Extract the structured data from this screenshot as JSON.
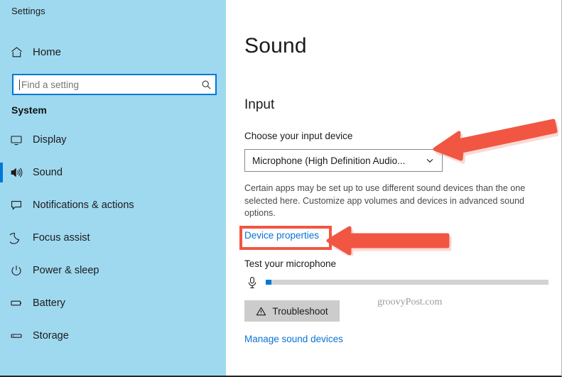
{
  "app": {
    "title": "Settings"
  },
  "sidebar": {
    "home": {
      "label": "Home",
      "icon": "home-icon"
    },
    "search": {
      "placeholder": "Find a setting",
      "value": "",
      "icon": "search-icon"
    },
    "group_title": "System",
    "items": [
      {
        "label": "Display",
        "icon": "monitor-icon",
        "selected": false
      },
      {
        "label": "Sound",
        "icon": "speaker-icon",
        "selected": true
      },
      {
        "label": "Notifications & actions",
        "icon": "chat-bubble-icon",
        "selected": false
      },
      {
        "label": "Focus assist",
        "icon": "moon-icon",
        "selected": false
      },
      {
        "label": "Power & sleep",
        "icon": "power-icon",
        "selected": false
      },
      {
        "label": "Battery",
        "icon": "battery-icon",
        "selected": false
      },
      {
        "label": "Storage",
        "icon": "drive-icon",
        "selected": false
      }
    ]
  },
  "main": {
    "page_title": "Sound",
    "section_input": "Input",
    "input_device_label": "Choose your input device",
    "input_device_value": "Microphone (High Definition Audio...",
    "apps_note": "Certain apps may be set up to use different sound devices than the one selected here. Customize app volumes and devices in advanced sound options.",
    "device_properties_link": "Device properties",
    "test_mic_label": "Test your microphone",
    "mic_icon": "microphone-icon",
    "level_percent": 2,
    "troubleshoot_label": "Troubleshoot",
    "troubleshoot_icon": "warning-triangle-icon",
    "manage_sound_devices_link": "Manage sound devices",
    "watermark": "groovyPost.com"
  },
  "colors": {
    "sidebar_bg": "#9fd9ef",
    "accent": "#0078d7",
    "link": "#0a73d6",
    "annotation_red": "#f15642",
    "button_gray": "#cccccc"
  }
}
